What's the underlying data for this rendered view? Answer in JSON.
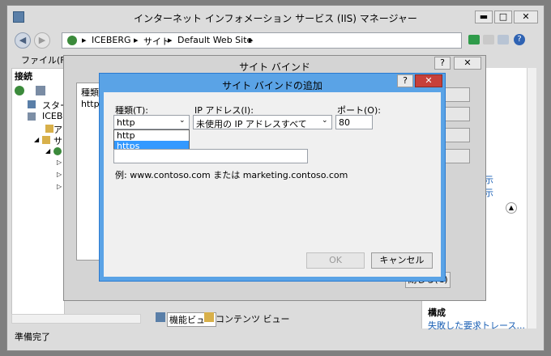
{
  "window": {
    "title": "インターネット インフォメーション サービス (IIS) マネージャー",
    "min_label": "▬",
    "max_label": "□",
    "close_label": "✕"
  },
  "address": {
    "crumbs": [
      "ICEBERG",
      "サイト",
      "Default Web Site"
    ],
    "sep": "▸"
  },
  "menu": {
    "file": "ファイル(F)"
  },
  "left_panel": {
    "title": "接続",
    "tree": [
      "スタート",
      "ICEBE",
      "アプ",
      "サ"
    ]
  },
  "binding_dialog": {
    "title": "サイト バインド",
    "help_label": "?",
    "close_label": "✕",
    "col_type": "種類",
    "row_type": "http",
    "close_button": "閉じる(C)"
  },
  "add_dialog": {
    "title": "サイト バインドの追加",
    "help_label": "?",
    "close_label": "✕",
    "type_label": "種類(T):",
    "type_value": "http",
    "type_options": [
      "http",
      "https"
    ],
    "ip_label": "IP アドレス(I):",
    "ip_value": "未使用の IP アドレスすべて",
    "port_label": "ポート(O):",
    "port_value": "80",
    "hostname_value": "",
    "example": "例: www.contoso.com または marketing.contoso.com",
    "ok": "OK",
    "cancel": "キャンセル"
  },
  "right_panel": {
    "link1": "示",
    "link2": "示",
    "section_title": "構成",
    "link3": "失敗した要求トレース..."
  },
  "bottom_tabs": {
    "features": "機能ビュー",
    "content": "コンテンツ ビュー"
  },
  "status": {
    "text": "準備完了"
  },
  "colors": {
    "accent": "#3399ff",
    "dialog_border": "#2b7bd0",
    "close_red": "#c7403a"
  }
}
